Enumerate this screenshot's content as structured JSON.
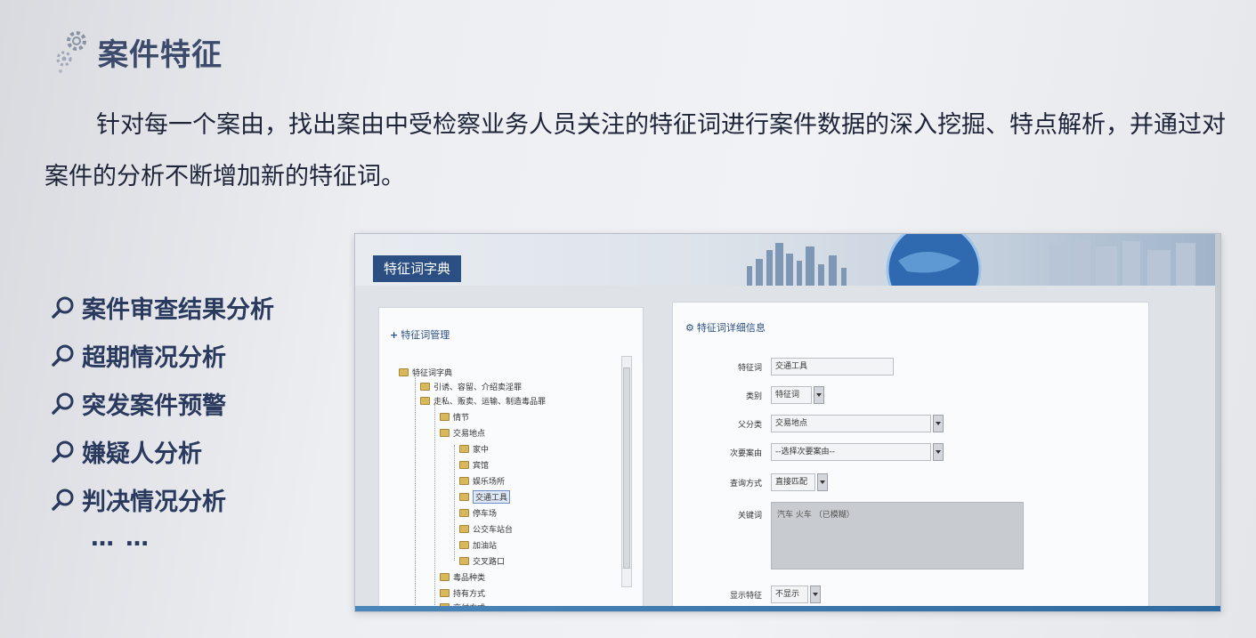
{
  "heading": {
    "title": "案件特征",
    "icon": "gear-icon"
  },
  "intro": {
    "line1": "针对每一个案由，找出案由中受检察业务人员关注的特征词进行案件数据的深入挖掘、特点解",
    "line2": "析，并通过对案件的分析不断增加新的特征词。"
  },
  "features": [
    "案件审查结果分析",
    "超期情况分析",
    "突发案件预警",
    "嫌疑人分析",
    "判决情况分析"
  ],
  "ellipsis": "… …",
  "app": {
    "banner_title": "特征词字典",
    "tree_panel": {
      "title": "特征词管理",
      "items": [
        "特征词字典",
        "引诱、容留、介绍卖淫罪",
        "走私、贩卖、运输、制造毒品罪",
        "情节",
        "交易地点",
        "家中",
        "宾馆",
        "娱乐场所",
        "交通工具",
        "停车场",
        "公交车站台",
        "加油站",
        "交叉路口",
        "毒品种类",
        "持有方式",
        "交付方式"
      ],
      "selected": "交通工具"
    },
    "detail_panel": {
      "title": "特征词详细信息",
      "fields": {
        "word_label": "特征词",
        "word_value": "交通工具",
        "category_label": "类别",
        "category_value": "特征词",
        "parent_label": "父分类",
        "parent_value": "交易地点",
        "cause_label": "次要案由",
        "cause_value": "--选择次要案由--",
        "match_label": "查询方式",
        "match_value": "直接匹配",
        "keyword_label": "关键词",
        "keyword_value": "汽车 火车 （已模糊）",
        "display_label": "显示特征",
        "display_value": "不显示"
      }
    }
  },
  "colors": {
    "accent": "#2b4f82",
    "text": "#2a3a5e"
  }
}
